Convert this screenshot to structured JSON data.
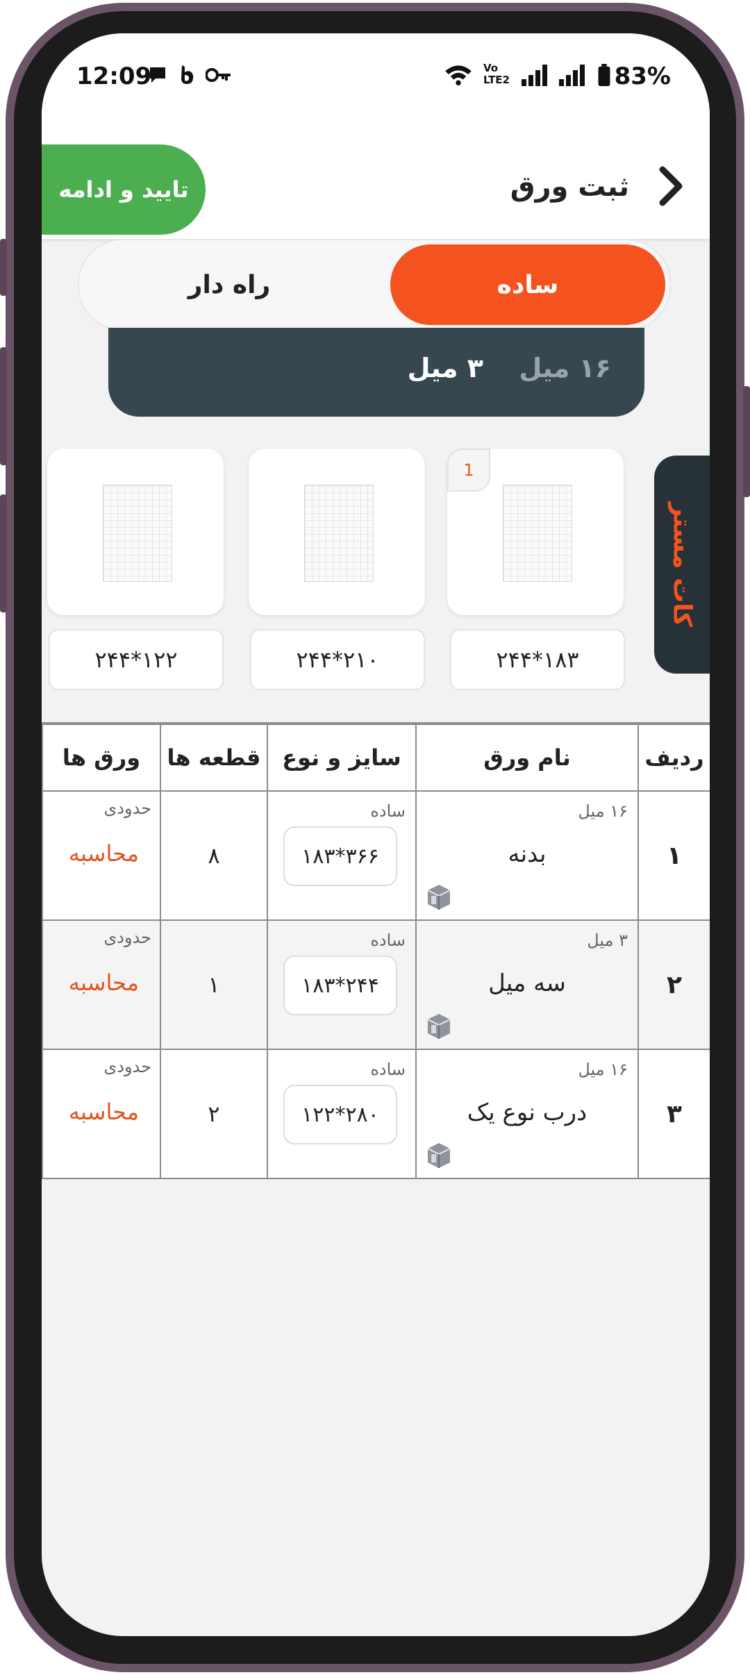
{
  "status_bar": {
    "time": "12:09",
    "battery": "83%",
    "network": "Vo LTE2",
    "icons": [
      "message-icon",
      "b-app-icon",
      "key-icon",
      "wifi-icon",
      "signal-icon",
      "signal-icon",
      "battery-icon"
    ]
  },
  "header": {
    "title": "ثبت ورق",
    "confirm_label": "تایید و ادامه",
    "back_icon": "chevron-right-icon",
    "confirm_color": "#4bae4f"
  },
  "toggle": {
    "active": "ساده",
    "inactive": "راه دار",
    "active_color": "#f4531f"
  },
  "thickness": {
    "selected": "۳ میل",
    "other": "۱۶ میل"
  },
  "side_tab": {
    "label": "کات مستر"
  },
  "sheets": [
    {
      "badge": "1",
      "size": "۲۴۴*۱۸۳"
    },
    {
      "badge": "",
      "size": "۲۴۴*۲۱۰"
    },
    {
      "badge": "",
      "size": "۲۴۴*۱۲۲"
    }
  ],
  "table": {
    "headers": {
      "row": "ردیف",
      "name": "نام ورق",
      "size": "سایز و نوع",
      "pieces": "قطعه ها",
      "sheets": "ورق ها"
    },
    "rows": [
      {
        "num": "۱",
        "thickness": "۱۶ میل",
        "name": "بدنه",
        "type": "ساده",
        "size": "۳۶۶*۱۸۳",
        "pieces": "۸",
        "approx": "حدودی",
        "action": "محاسبه"
      },
      {
        "num": "۲",
        "thickness": "۳ میل",
        "name": "سه میل",
        "type": "ساده",
        "size": "۲۴۴*۱۸۳",
        "pieces": "۱",
        "approx": "حدودی",
        "action": "محاسبه"
      },
      {
        "num": "۳",
        "thickness": "۱۶ میل",
        "name": "درب نوع یک",
        "type": "ساده",
        "size": "۲۸۰*۱۲۲",
        "pieces": "۲",
        "approx": "حدودی",
        "action": "محاسبه"
      }
    ]
  }
}
